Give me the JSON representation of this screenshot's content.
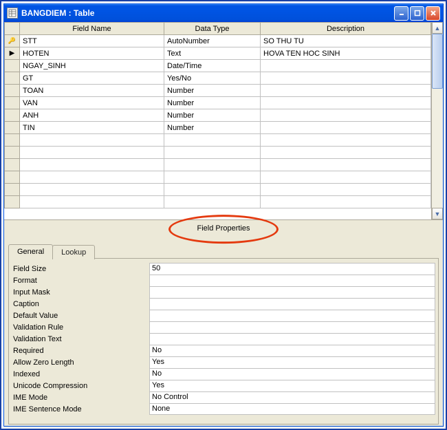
{
  "window": {
    "title": "BANGDIEM : Table"
  },
  "grid": {
    "headers": {
      "field_name": "Field Name",
      "data_type": "Data Type",
      "description": "Description"
    },
    "rows": [
      {
        "selector": "key",
        "name": "STT",
        "type": "AutoNumber",
        "desc": "SO THU TU"
      },
      {
        "selector": "arrow",
        "name": "HOTEN",
        "type": "Text",
        "desc": "HOVA TEN HOC SINH"
      },
      {
        "selector": "",
        "name": "NGAY_SINH",
        "type": "Date/Time",
        "desc": ""
      },
      {
        "selector": "",
        "name": "GT",
        "type": "Yes/No",
        "desc": ""
      },
      {
        "selector": "",
        "name": "TOAN",
        "type": "Number",
        "desc": ""
      },
      {
        "selector": "",
        "name": "VAN",
        "type": "Number",
        "desc": ""
      },
      {
        "selector": "",
        "name": "ANH",
        "type": "Number",
        "desc": ""
      },
      {
        "selector": "",
        "name": "TIN",
        "type": "Number",
        "desc": ""
      },
      {
        "selector": "",
        "name": "",
        "type": "",
        "desc": ""
      },
      {
        "selector": "",
        "name": "",
        "type": "",
        "desc": ""
      },
      {
        "selector": "",
        "name": "",
        "type": "",
        "desc": ""
      },
      {
        "selector": "",
        "name": "",
        "type": "",
        "desc": ""
      },
      {
        "selector": "",
        "name": "",
        "type": "",
        "desc": ""
      },
      {
        "selector": "",
        "name": "",
        "type": "",
        "desc": ""
      }
    ]
  },
  "section_label": "Field Properties",
  "tabs": {
    "general": "General",
    "lookup": "Lookup"
  },
  "properties": [
    {
      "label": "Field Size",
      "value": "50"
    },
    {
      "label": "Format",
      "value": ""
    },
    {
      "label": "Input Mask",
      "value": ""
    },
    {
      "label": "Caption",
      "value": ""
    },
    {
      "label": "Default Value",
      "value": ""
    },
    {
      "label": "Validation Rule",
      "value": ""
    },
    {
      "label": "Validation Text",
      "value": ""
    },
    {
      "label": "Required",
      "value": "No"
    },
    {
      "label": "Allow Zero Length",
      "value": "Yes"
    },
    {
      "label": "Indexed",
      "value": "No"
    },
    {
      "label": "Unicode Compression",
      "value": "Yes"
    },
    {
      "label": "IME Mode",
      "value": "No Control"
    },
    {
      "label": "IME Sentence Mode",
      "value": "None"
    }
  ]
}
